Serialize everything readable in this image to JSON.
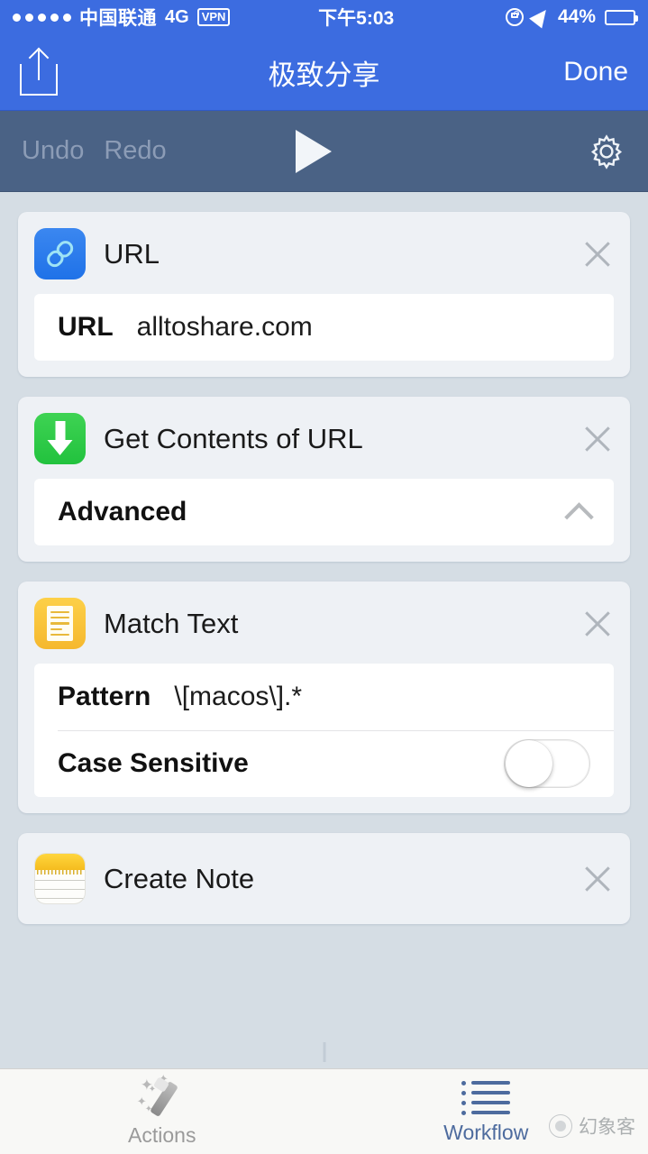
{
  "status_bar": {
    "signal_dots": 5,
    "carrier": "中国联通",
    "network": "4G",
    "vpn": "VPN",
    "time": "下午5:03",
    "rotation_lock_icon": "rotation-lock-icon",
    "location_icon": "location-arrow-icon",
    "battery_percent": "44%",
    "battery_level": 44
  },
  "nav_bar": {
    "share_icon": "share-icon",
    "title": "极致分享",
    "done_label": "Done"
  },
  "toolbar": {
    "undo_label": "Undo",
    "redo_label": "Redo",
    "play_icon": "play-icon",
    "settings_icon": "gear-icon"
  },
  "actions": [
    {
      "icon": "link-icon",
      "title": "URL",
      "close_icon": "close-icon",
      "params": [
        {
          "type": "text",
          "label": "URL",
          "value": "alltoshare.com"
        }
      ]
    },
    {
      "icon": "download-arrow-icon",
      "title": "Get Contents of URL",
      "close_icon": "close-icon",
      "params": [
        {
          "type": "disclosure",
          "label": "Advanced",
          "chevron": "chevron-up-icon"
        }
      ]
    },
    {
      "icon": "match-text-icon",
      "title": "Match Text",
      "close_icon": "close-icon",
      "params": [
        {
          "type": "text",
          "label": "Pattern",
          "value": "\\[macos\\].*"
        },
        {
          "type": "toggle",
          "label": "Case Sensitive",
          "value": false
        }
      ]
    },
    {
      "icon": "notes-icon",
      "title": "Create Note",
      "close_icon": "close-icon",
      "params": []
    }
  ],
  "tab_bar": {
    "tabs": [
      {
        "icon": "magic-wand-icon",
        "label": "Actions",
        "selected": false
      },
      {
        "icon": "list-icon",
        "label": "Workflow",
        "selected": true
      }
    ]
  },
  "watermark": {
    "logo": "watermark-logo-icon",
    "text": "幻象客"
  },
  "colors": {
    "nav_blue": "#3c6ce0",
    "toolbar_slate": "#4a6285",
    "page_bg": "#d5dde4",
    "card_bg": "#eef1f5",
    "accent_tab": "#4d6b9e"
  }
}
